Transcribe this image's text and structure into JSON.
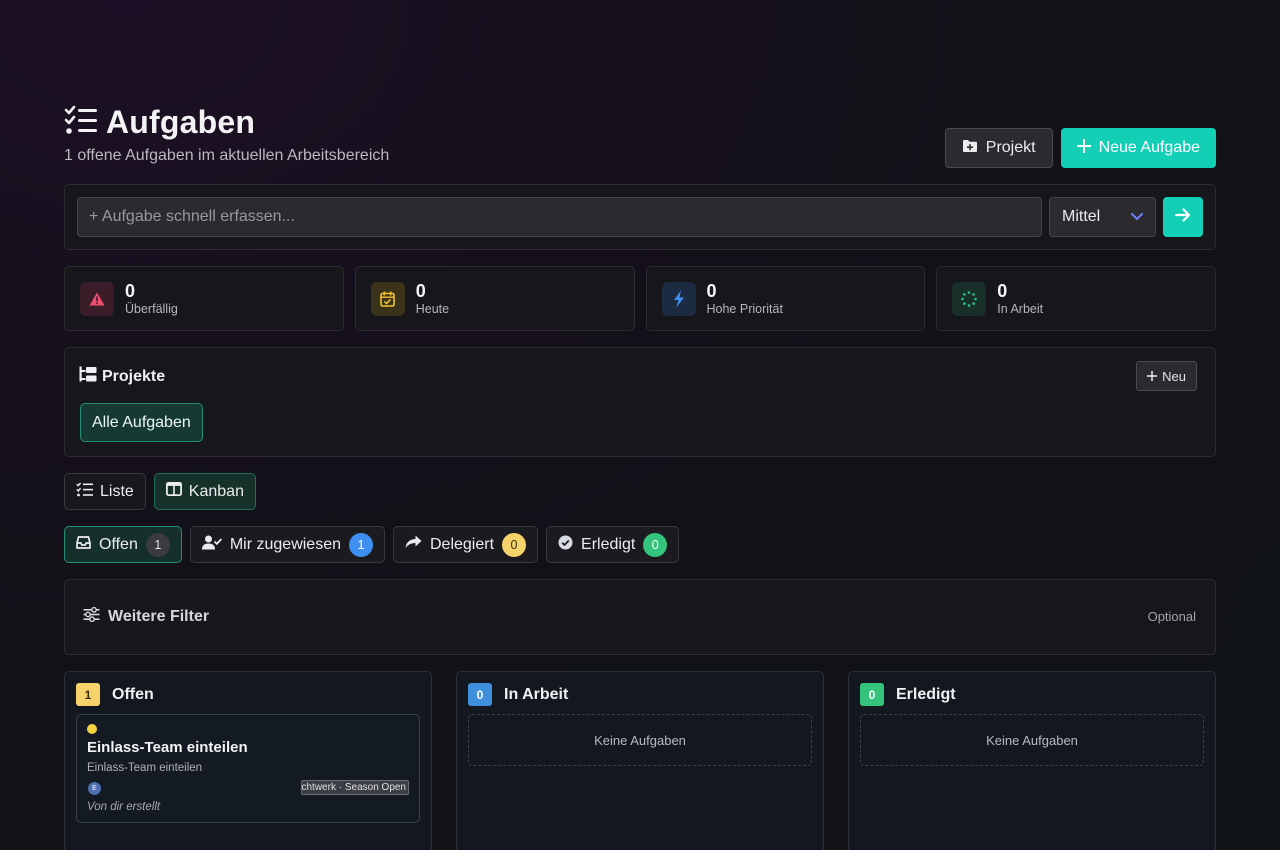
{
  "header": {
    "title": "Aufgaben",
    "subtitle": "1 offene Aufgaben im aktuellen Arbeitsbereich",
    "project_button": "Projekt",
    "new_task_button": "Neue Aufgabe"
  },
  "quick_add": {
    "placeholder": "+ Aufgabe schnell erfassen...",
    "priority_value": "Mittel"
  },
  "stats": [
    {
      "value": "0",
      "label": "Überfällig",
      "icon": "warning-triangle-icon",
      "color": "#ef4d6e"
    },
    {
      "value": "0",
      "label": "Heute",
      "icon": "calendar-check-icon",
      "color": "#f1c232"
    },
    {
      "value": "0",
      "label": "Hohe Priorität",
      "icon": "lightning-bolt-icon",
      "color": "#3f8ff0"
    },
    {
      "value": "0",
      "label": "In Arbeit",
      "icon": "spinner-icon",
      "color": "#2bc48a"
    }
  ],
  "projects": {
    "title": "Projekte",
    "new_button": "Neu",
    "items": [
      "Alle Aufgaben"
    ]
  },
  "views": {
    "list_label": "Liste",
    "kanban_label": "Kanban",
    "active": "Kanban"
  },
  "tabs": [
    {
      "label": "Offen",
      "count": "1",
      "icon": "inbox-icon",
      "badge_color": "#3a3a40"
    },
    {
      "label": "Mir zugewiesen",
      "count": "1",
      "icon": "user-check-icon",
      "badge_color": "#3f8ff0"
    },
    {
      "label": "Delegiert",
      "count": "0",
      "icon": "share-arrow-icon",
      "badge_color": "#f6d36a"
    },
    {
      "label": "Erledigt",
      "count": "0",
      "icon": "check-circle-icon",
      "badge_color": "#34c47c"
    }
  ],
  "more_filters": {
    "title": "Weitere Filter",
    "optional_label": "Optional"
  },
  "board": {
    "columns": [
      {
        "title": "Offen",
        "count": "1",
        "count_color": "#f6d36a"
      },
      {
        "title": "In Arbeit",
        "count": "0",
        "count_color": "#3f8fdc"
      },
      {
        "title": "Erledigt",
        "count": "0",
        "count_color": "#34c47c"
      }
    ],
    "empty_text": "Keine Aufgaben",
    "card": {
      "title": "Einlass-Team einteilen",
      "description": "Einlass-Team einteilen",
      "avatar_initial": "E",
      "tag": "chtwerk · Season Open",
      "meta": "Von dir erstellt"
    }
  }
}
